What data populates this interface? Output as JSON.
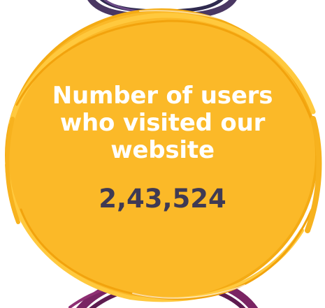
{
  "card": {
    "headline_lines": [
      "Number of users",
      "who visited our",
      "website"
    ],
    "visitor_count": "2,43,524"
  },
  "colors": {
    "circle_fill": "#fbb928",
    "circle_stroke": "#f5a91a",
    "top_ring": "#4a3763",
    "bottom_ring": "#7a2463",
    "headline_text": "#ffffff",
    "count_text": "#3f3a54"
  }
}
